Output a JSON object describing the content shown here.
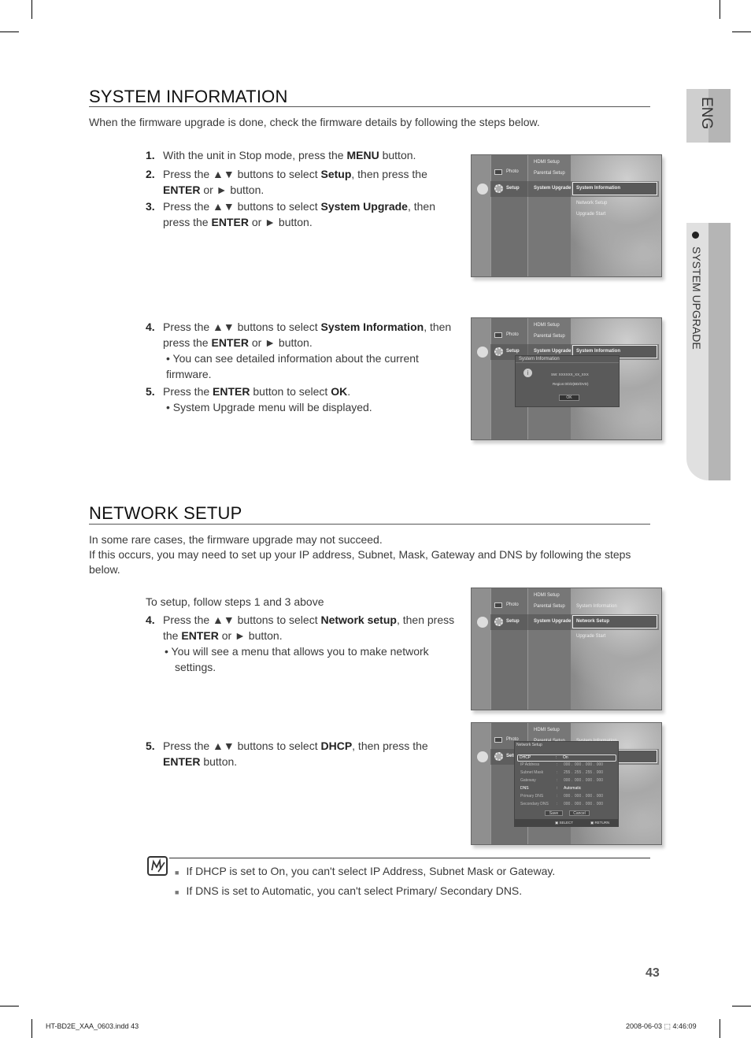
{
  "system_information": {
    "title": "SYSTEM INFORMATION",
    "intro": "When the firmware upgrade is done, check the firmware details by following the steps below.",
    "steps": [
      {
        "num": "1.",
        "pre": "With the unit in Stop mode, press the ",
        "b1": "MENU",
        "mid": " button.",
        "b2": "",
        "post": ""
      },
      {
        "num": "2.",
        "pre": "Press the ▲▼ buttons to select ",
        "b1": "Setup",
        "mid": ", then press the ",
        "b2": "ENTER",
        "post": " or ► button."
      },
      {
        "num": "3.",
        "pre": "Press the ▲▼ buttons to select ",
        "b1": "System Upgrade",
        "mid": ", then press the ",
        "b2": "ENTER",
        "post": " or ► button."
      },
      {
        "num": "4.",
        "pre": "Press the ▲▼ buttons to select ",
        "b1": "System Information",
        "mid": ", then press the ",
        "b2": "ENTER",
        "post": " or ► button."
      },
      {
        "num": "5.",
        "pre": "Press the ",
        "b1": "ENTER",
        "mid": " button to select ",
        "b2": "OK",
        "post": "."
      }
    ],
    "bullet4": "• You can see detailed information about the current firmware.",
    "bullet5": "• System Upgrade menu will be displayed."
  },
  "network_setup": {
    "title": "NETWORK SETUP",
    "intro1": "In some rare cases, the firmware upgrade may not succeed.",
    "intro2": "If this occurs, you may need to set up your IP address, Subnet, Mask, Gateway and DNS by following the steps below.",
    "lead": "To setup, follow steps 1 and 3 above",
    "steps": [
      {
        "num": "4.",
        "pre": "Press the ▲▼ buttons to select ",
        "b1": "Network setup",
        "mid": ", then press the ",
        "b2": "ENTER",
        "post": " or ► button."
      },
      {
        "num": "5.",
        "pre": "Press the ▲▼ buttons to select ",
        "b1": "DHCP",
        "mid": ", then press the ",
        "b2": "ENTER",
        "post": " button."
      }
    ],
    "bullet4": "• You will see a menu that allows you to make network settings."
  },
  "notes": [
    "If DHCP is set to On, you can't select IP Address, Subnet Mask or Gateway.",
    "If DNS is set to Automatic, you can't select Primary/ Secondary DNS."
  ],
  "note_bullet": "■",
  "screens": {
    "col1": [
      "Photo",
      "Setup"
    ],
    "col2": [
      "HDMI Setup",
      "Parental Setup",
      "System Upgrade"
    ],
    "col3": [
      "System Information",
      "Network Setup",
      "Upgrade Start"
    ],
    "sysinfo_dialog": {
      "title": "System Information",
      "sw": "SW: XXXXXX_XX_XXX",
      "region": "Region:0/0/2(BD/DVD)",
      "ok": "OK"
    },
    "network_dialog": {
      "title": "Network Setup",
      "rows": [
        {
          "label": "DHCP",
          "value": "On"
        },
        {
          "label": "IP Address",
          "value": "000 .  000 .  000 .  000"
        },
        {
          "label": "Subnet Mask",
          "value": "255 .  255 .  255 .  000"
        },
        {
          "label": "Gateway",
          "value": "000 .  000 .  000 .  000"
        },
        {
          "label": "DNS",
          "value": "Automatic"
        },
        {
          "label": "Primary DNS",
          "value": "000 .  000 .  000 .  000"
        },
        {
          "label": "Secondary DNS",
          "value": "000 .  000 .  000 .  000"
        }
      ],
      "save": "Save",
      "cancel": "Cancel",
      "select": "SELECT",
      "return": "RETURN"
    }
  },
  "side_tabs": {
    "lang": "ENG",
    "section": "SYSTEM UPGRADE"
  },
  "page_number": "43",
  "footer": {
    "file": "HT-BD2E_XAA_0603.indd   43",
    "date": "2008-06-03   ⬚ 4:46:09"
  }
}
